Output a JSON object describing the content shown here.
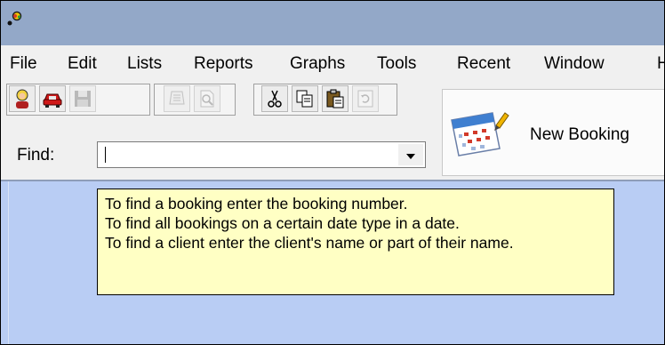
{
  "menu": {
    "items": [
      "File",
      "Edit",
      "Lists",
      "Reports",
      "Graphs",
      "Tools",
      "Recent",
      "Window",
      "H"
    ]
  },
  "toolbar": {
    "buttons": [
      {
        "name": "client-icon",
        "enabled": true
      },
      {
        "name": "car-icon",
        "enabled": true
      },
      {
        "name": "save-icon",
        "enabled": false
      },
      {
        "name": "print-icon",
        "enabled": false
      },
      {
        "name": "print-preview-icon",
        "enabled": false
      },
      {
        "name": "cut-icon",
        "enabled": true
      },
      {
        "name": "copy-icon",
        "enabled": true
      },
      {
        "name": "paste-icon",
        "enabled": true
      },
      {
        "name": "refresh-icon",
        "enabled": false
      }
    ]
  },
  "find": {
    "label": "Find:",
    "value": ""
  },
  "new_booking": {
    "label": "New Booking",
    "icon": "calendar-icon"
  },
  "tooltip": {
    "lines": [
      "To find a booking enter the booking number.",
      "To find all bookings on a certain date type in a date.",
      "To find a client enter the client's name or part of their name."
    ]
  }
}
